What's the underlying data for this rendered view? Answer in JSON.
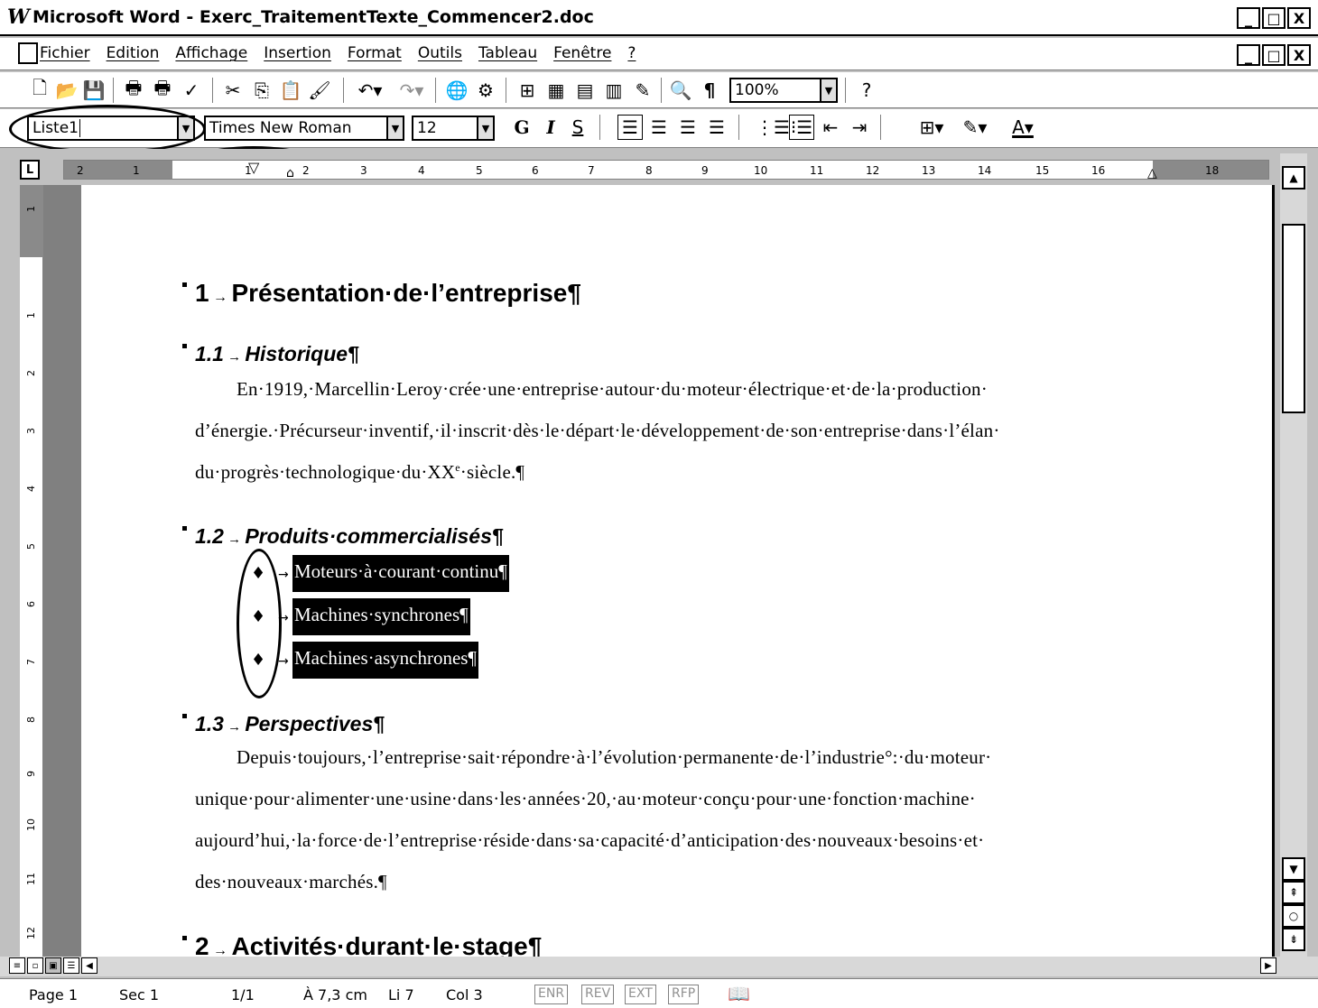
{
  "window": {
    "app_glyph": "W",
    "title": "Microsoft Word - Exerc_TraitementTexte_Commencer2.doc",
    "buttons": [
      "_",
      "□",
      "X"
    ]
  },
  "menubar": {
    "items": [
      "Fichier",
      "Edition",
      "Affichage",
      "Insertion",
      "Format",
      "Outils",
      "Tableau",
      "Fenêtre",
      "?"
    ],
    "doc_buttons": [
      "_",
      "□",
      "X"
    ]
  },
  "standard_toolbar": {
    "icons": [
      "new-doc-icon",
      "open-folder-icon",
      "save-icon",
      "print-icon",
      "print-preview-icon",
      "spelling-icon",
      "cut-icon",
      "copy-icon",
      "paste-icon",
      "format-painter-icon",
      "undo-icon",
      "redo-icon",
      "hyperlink-icon",
      "web-icon",
      "tables-borders-icon",
      "insert-table-icon",
      "insert-excel-icon",
      "columns-icon",
      "drawing-icon",
      "document-map-icon",
      "show-formatting-icon",
      "help-icon"
    ],
    "zoom": "100%"
  },
  "format_toolbar": {
    "style": "Liste1",
    "font": "Times New Roman",
    "size": "12",
    "bold_label": "G",
    "italic_label": "I",
    "underline_label": "S"
  },
  "ruler": {
    "marks": [
      "2",
      "1",
      "1",
      "2",
      "3",
      "4",
      "5",
      "6",
      "7",
      "8",
      "9",
      "10",
      "11",
      "12",
      "13",
      "14",
      "15",
      "16",
      "18"
    ],
    "vertical_marks": [
      "1",
      "1",
      "2",
      "3",
      "4",
      "5",
      "6",
      "7",
      "8",
      "9",
      "10",
      "11",
      "12"
    ]
  },
  "document": {
    "h1_1_num": "1",
    "h1_1_text": "Présentation·de·l’entreprise¶",
    "h2_1_num": "1.1",
    "h2_1_text": "Historique¶",
    "p1_line1": "En·1919,·Marcellin·Leroy·crée·une·entreprise·autour·du·moteur·électrique·et·de·la·production·",
    "p1_line2": "d’énergie.·Précurseur·inventif,·il·inscrit·dès·le·départ·le·développement·de·son·entreprise·dans·l’élan·",
    "p1_line3": "du·progrès·technologique·du·XX",
    "p1_line3_sup": "e",
    "p1_line3_end": "·siècle.¶",
    "h2_2_num": "1.2",
    "h2_2_text": "Produits·commercialisés¶",
    "bullet_glyph": "♦",
    "arrow_glyph": "→",
    "list": [
      "Moteurs·à·courant·continu¶",
      "Machines·synchrones¶",
      "Machines·asynchrones¶"
    ],
    "h2_3_num": "1.3",
    "h2_3_text": "Perspectives¶",
    "p2_line1": "Depuis·toujours,·l’entreprise·sait·répondre·à·l’évolution·permanente·de·l’industrie°:·du·moteur·",
    "p2_line2": "unique·pour·alimenter·une·usine·dans·les·années·20,·au·moteur·conçu·pour·une·fonction·machine·",
    "p2_line3": "aujourd’hui,·la·force·de·l’entreprise·réside·dans·sa·capacité·d’anticipation·des·nouveaux·besoins·et·",
    "p2_line4": "des·nouveaux·marchés.¶",
    "h1_2_num": "2",
    "h1_2_text": "Activités·durant·le·stage¶"
  },
  "statusbar": {
    "page": "Page 1",
    "sec": "Sec 1",
    "pages": "1/1",
    "at": "À 7,3 cm",
    "line": "Li 7",
    "col": "Col 3",
    "modes": [
      "ENR",
      "REV",
      "EXT",
      "RFP"
    ]
  }
}
